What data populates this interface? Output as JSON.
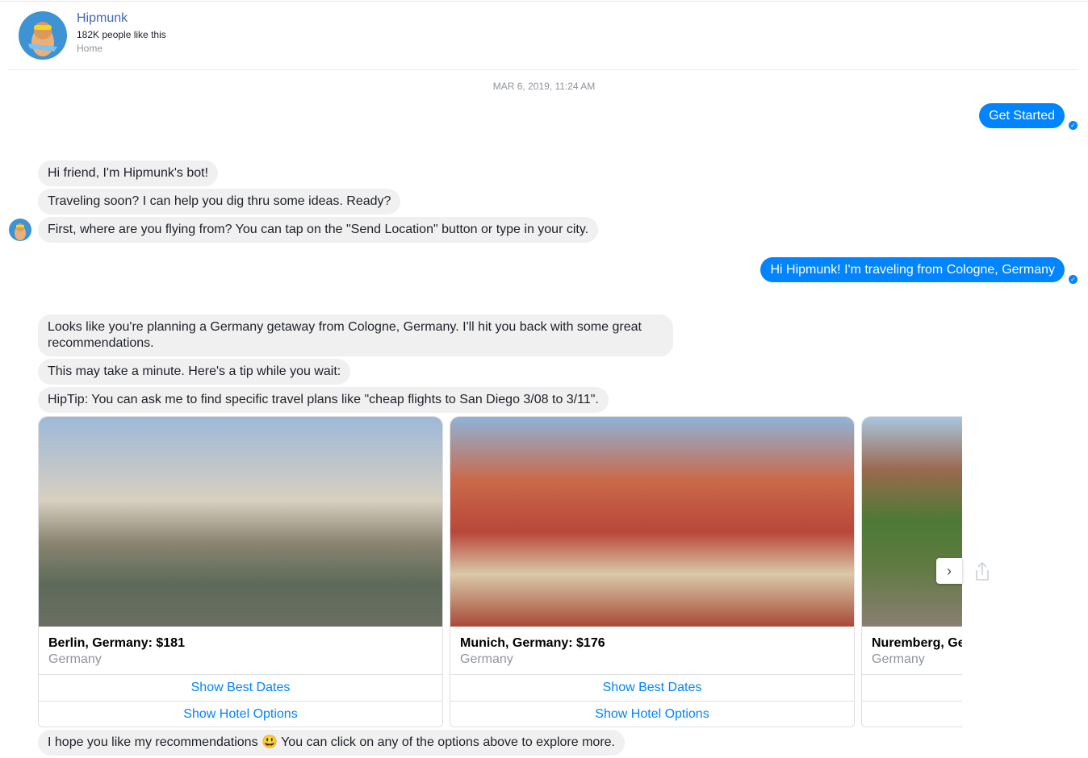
{
  "page": {
    "name": "Hipmunk",
    "likes": "182K people like this",
    "category": "Home"
  },
  "timestamp": "MAR 6, 2019, 11:24 AM",
  "messages": {
    "user1": "Get Started",
    "bot1": "Hi friend, I'm Hipmunk's bot!",
    "bot2": "Traveling soon? I can help you dig thru some ideas. Ready?",
    "bot3": "First, where are you flying from? You can tap on the \"Send Location\" button or type in your city.",
    "user2": "Hi Hipmunk! I'm traveling from Cologne, Germany",
    "bot4": "Looks like you're planning a Germany getaway from Cologne, Germany. I'll hit you back with some great recommendations.",
    "bot5": "This may take a minute. Here's a tip while you wait:",
    "bot6": "HipTip: You can ask me to find specific travel plans like \"cheap flights to San Diego 3/08 to 3/11\".",
    "bot7": "I hope you like my recommendations 😃 You can click on any of the options above to explore more."
  },
  "cards": [
    {
      "title": "Berlin, Germany: $181",
      "subtitle": "Germany",
      "buttons": [
        "Show Best Dates",
        "Show Hotel Options"
      ]
    },
    {
      "title": "Munich, Germany: $176",
      "subtitle": "Germany",
      "buttons": [
        "Show Best Dates",
        "Show Hotel Options"
      ]
    },
    {
      "title": "Nuremberg, Germany",
      "subtitle": "Germany",
      "buttons": [
        "",
        ""
      ]
    }
  ],
  "icons": {
    "next": "›",
    "check": "✓"
  }
}
